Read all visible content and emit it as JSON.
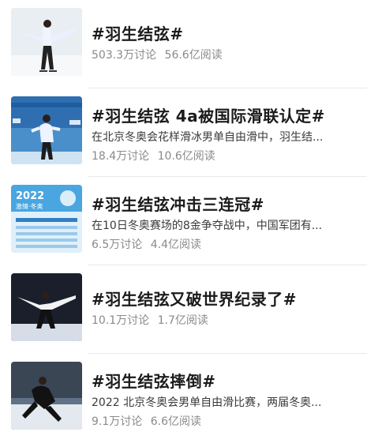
{
  "topics": [
    {
      "title": "#羽生结弦#",
      "description": "",
      "discussions": "503.3万讨论",
      "reads": "56.6亿阅读",
      "thumbnail": "skater-white-costume-icon"
    },
    {
      "title": "#羽生结弦 4a被国际滑联认定#",
      "description": "在北京冬奥会花样滑冰男单自由滑中，羽生结...",
      "discussions": "18.4万讨论",
      "reads": "10.6亿阅读",
      "thumbnail": "skater-olympic-backdrop-icon"
    },
    {
      "title": "#羽生结弦冲击三连冠#",
      "description": "在10日冬奥赛场的8金争夺战中，中国军团有...",
      "discussions": "6.5万讨论",
      "reads": "4.4亿阅读",
      "thumbnail": "olympic-schedule-poster-icon",
      "poster": {
        "year": "2022",
        "subtitle": "激情·冬奥"
      }
    },
    {
      "title": "#羽生结弦又破世界纪录了#",
      "description": "",
      "discussions": "10.1万讨论",
      "reads": "1.7亿阅读",
      "thumbnail": "skater-dark-arena-icon"
    },
    {
      "title": "#羽生结弦摔倒#",
      "description": "2022 北京冬奥会男单自由滑比赛，两届冬奥...",
      "discussions": "9.1万讨论",
      "reads": "6.6亿阅读",
      "thumbnail": "skater-black-costume-icon"
    }
  ],
  "colors": {
    "title": "#1b1b1b",
    "description": "#3a3a3a",
    "stats": "#8a8a8a",
    "divider": "#e9e9e9"
  }
}
